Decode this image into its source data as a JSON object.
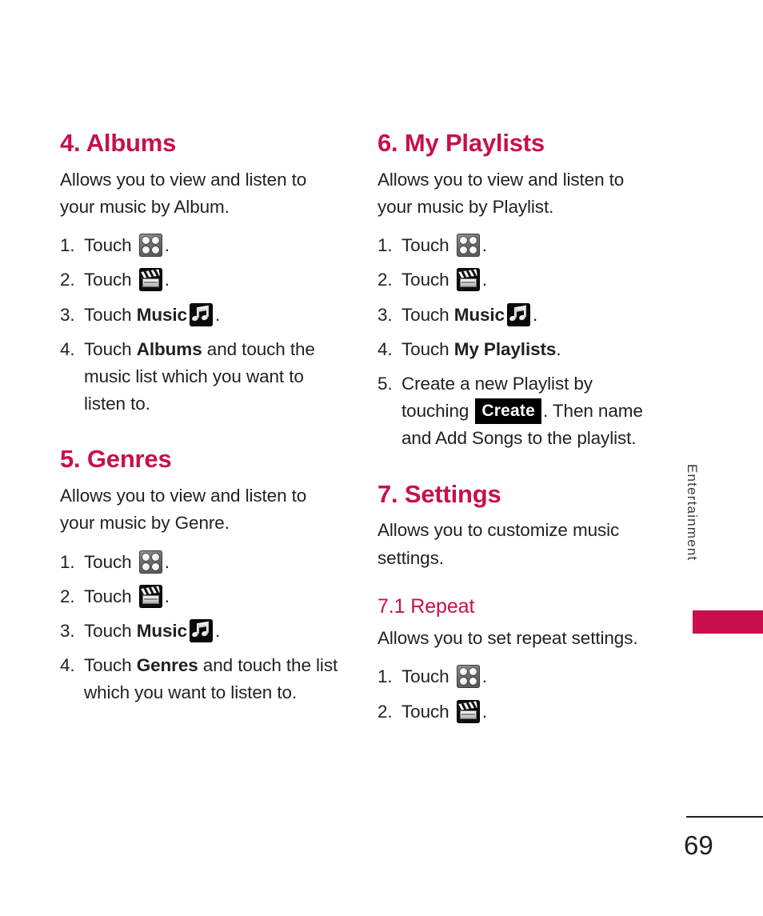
{
  "page": {
    "number": "69",
    "side_tab_label": "Entertainment",
    "accent_color": "#c8104a",
    "text_color": "#231f20",
    "background_color": "#ffffff"
  },
  "columns": {
    "left": {
      "sections": [
        {
          "title": "4. Albums",
          "intro": "Allows you to view and listen to your music by Album.",
          "steps": [
            {
              "num": "1.",
              "pre": "Touch ",
              "icon": "grid-menu-icon",
              "post": "."
            },
            {
              "num": "2.",
              "pre": "Touch ",
              "icon": "clapperboard-multimedia-icon",
              "post": "."
            },
            {
              "num": "3.",
              "pre": "Touch ",
              "bold": "Music",
              "icon": "music-note-icon",
              "post": "."
            },
            {
              "num": "4.",
              "pre": "Touch ",
              "bold": "Albums",
              "post": " and touch the music list which you want to listen to."
            }
          ]
        },
        {
          "title": "5. Genres",
          "intro": "Allows you to view and listen to your music by Genre.",
          "steps": [
            {
              "num": "1.",
              "pre": "Touch ",
              "icon": "grid-menu-icon",
              "post": "."
            },
            {
              "num": "2.",
              "pre": "Touch ",
              "icon": "clapperboard-multimedia-icon",
              "post": "."
            },
            {
              "num": "3.",
              "pre": "Touch ",
              "bold": "Music",
              "icon": "music-note-icon",
              "post": "."
            },
            {
              "num": "4.",
              "pre": "Touch ",
              "bold": "Genres",
              "post": " and touch the list which you want to listen to."
            }
          ]
        }
      ]
    },
    "right": {
      "sections": [
        {
          "title": "6. My Playlists",
          "intro": "Allows you to view and listen to your music by Playlist.",
          "steps": [
            {
              "num": "1.",
              "pre": "Touch ",
              "icon": "grid-menu-icon",
              "post": "."
            },
            {
              "num": "2.",
              "pre": "Touch ",
              "icon": "clapperboard-multimedia-icon",
              "post": "."
            },
            {
              "num": "3.",
              "pre": "Touch ",
              "bold": "Music",
              "icon": "music-note-icon",
              "post": "."
            },
            {
              "num": "4.",
              "pre": "Touch ",
              "bold": "My Playlists",
              "post": "."
            },
            {
              "num": "5.",
              "pre": "Create a new Playlist by touching ",
              "key": "Create",
              "post": ". Then name and Add Songs to the playlist."
            }
          ]
        },
        {
          "title": "7. Settings",
          "intro": "Allows you to customize music settings.",
          "subsection": {
            "title": "7.1 Repeat",
            "intro": "Allows you to set repeat settings.",
            "steps": [
              {
                "num": "1.",
                "pre": "Touch ",
                "icon": "grid-menu-icon",
                "post": "."
              },
              {
                "num": "2.",
                "pre": "Touch ",
                "icon": "clapperboard-multimedia-icon",
                "post": "."
              }
            ]
          }
        }
      ]
    }
  }
}
